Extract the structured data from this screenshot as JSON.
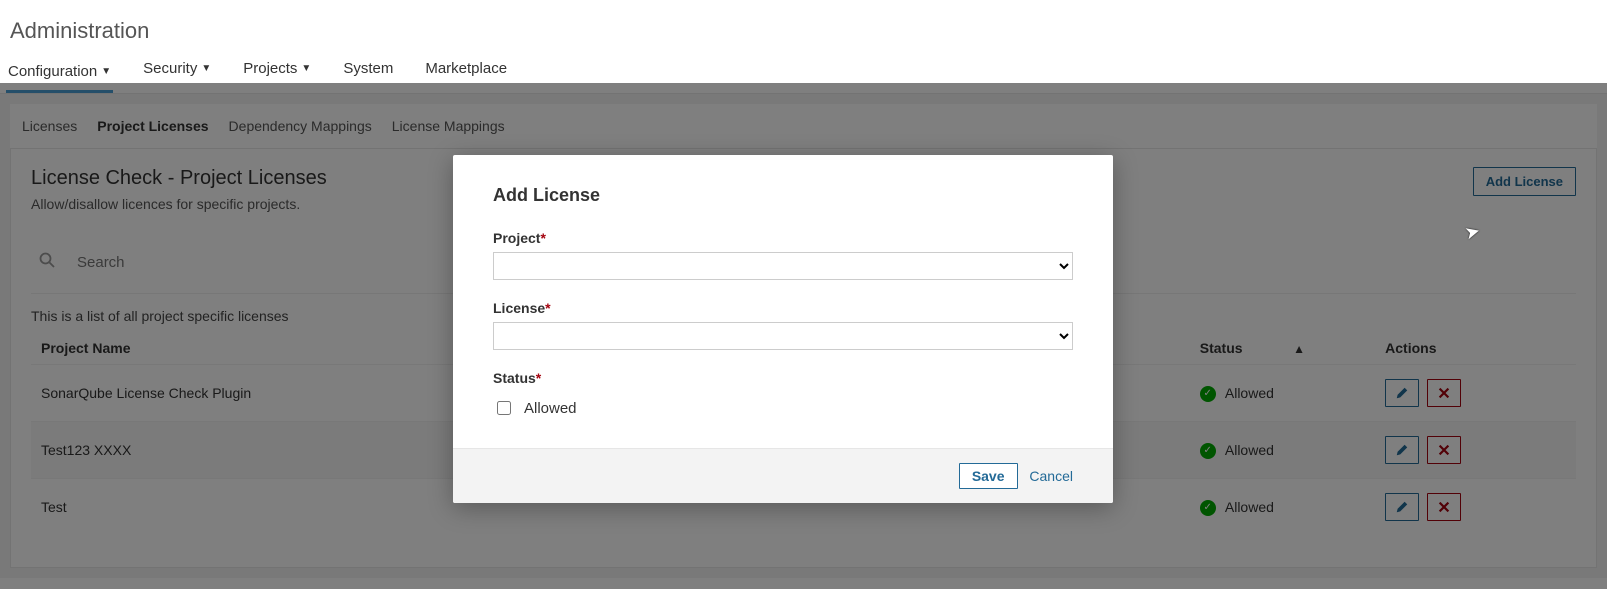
{
  "pageTitle": "Administration",
  "topnav": {
    "items": [
      {
        "label": "Configuration",
        "caret": true,
        "active": true
      },
      {
        "label": "Security",
        "caret": true,
        "active": false
      },
      {
        "label": "Projects",
        "caret": true,
        "active": false
      },
      {
        "label": "System",
        "caret": false,
        "active": false
      },
      {
        "label": "Marketplace",
        "caret": false,
        "active": false
      }
    ]
  },
  "subnav": {
    "items": [
      {
        "label": "Licenses",
        "active": false
      },
      {
        "label": "Project Licenses",
        "active": true
      },
      {
        "label": "Dependency Mappings",
        "active": false
      },
      {
        "label": "License Mappings",
        "active": false
      }
    ]
  },
  "panel": {
    "title": "License Check - Project Licenses",
    "subtitle": "Allow/disallow licences for specific projects.",
    "addButton": "Add License",
    "searchPlaceholder": "Search",
    "listDesc": "This is a list of all project specific licenses",
    "columns": {
      "projectName": "Project Name",
      "status": "Status",
      "actions": "Actions"
    },
    "sortTriangle": "▲",
    "statusAllowed": "Allowed",
    "rows": [
      {
        "project": "SonarQube License Check Plugin",
        "status": "Allowed"
      },
      {
        "project": "Test123 XXXX",
        "status": "Allowed"
      },
      {
        "project": "Test",
        "status": "Allowed"
      }
    ]
  },
  "modal": {
    "title": "Add License",
    "projectLabel": "Project",
    "licenseLabel": "License",
    "statusLabel": "Status",
    "allowedLabel": "Allowed",
    "save": "Save",
    "cancel": "Cancel"
  }
}
